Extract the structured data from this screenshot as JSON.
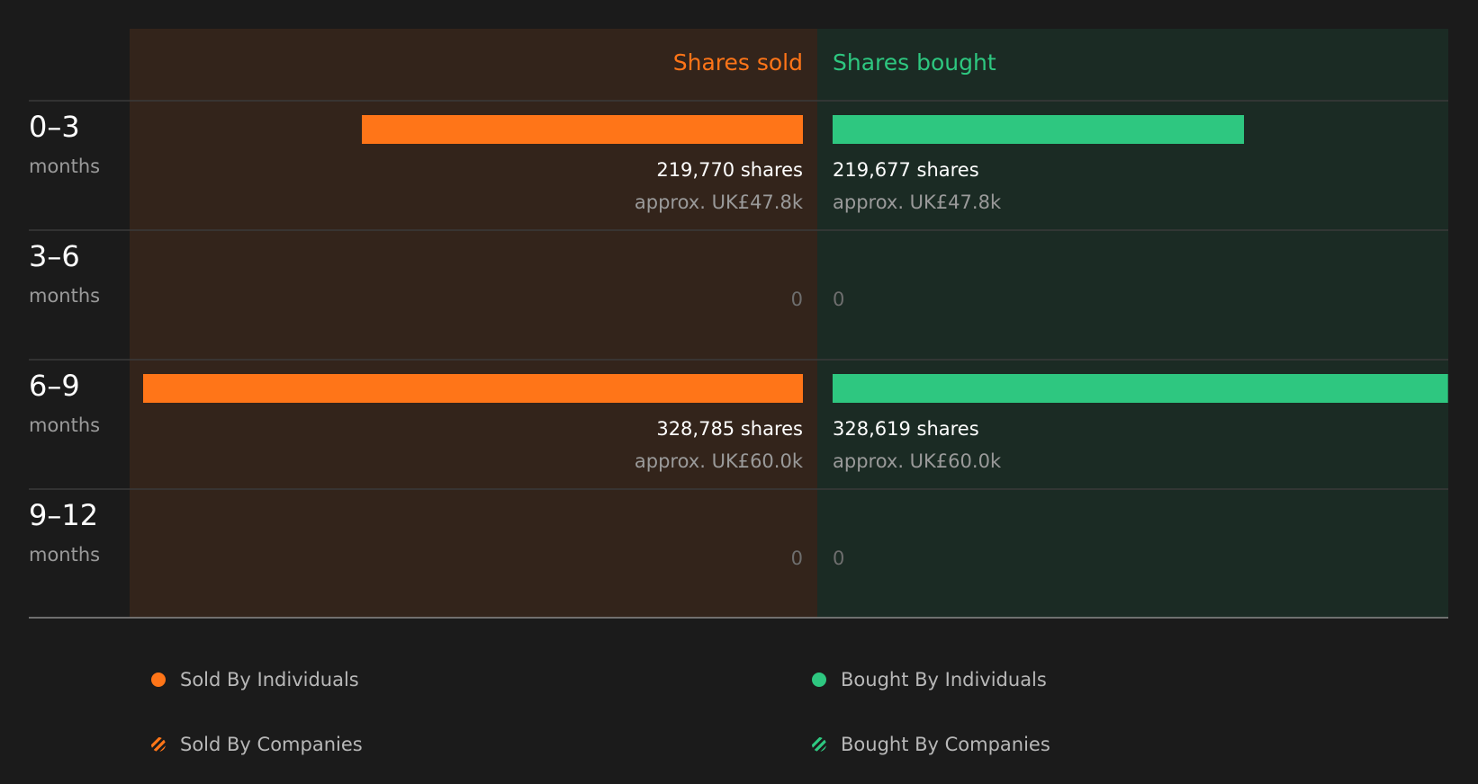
{
  "chart_data": {
    "type": "bar",
    "orientation": "diverging-horizontal",
    "sold_header": "Shares sold",
    "bought_header": "Shares bought",
    "max_shares": 328785,
    "categories": [
      {
        "range": "0–3",
        "unit": "months"
      },
      {
        "range": "3–6",
        "unit": "months"
      },
      {
        "range": "6–9",
        "unit": "months"
      },
      {
        "range": "9–12",
        "unit": "months"
      }
    ],
    "series": [
      {
        "name": "Shares sold",
        "values": [
          219770,
          0,
          328785,
          0
        ],
        "value_labels": [
          "219,770 shares",
          "0",
          "328,785 shares",
          "0"
        ],
        "approx_labels": [
          "approx. UK£47.8k",
          "",
          "approx. UK£60.0k",
          ""
        ]
      },
      {
        "name": "Shares bought",
        "values": [
          219677,
          0,
          328619,
          0
        ],
        "value_labels": [
          "219,677 shares",
          "0",
          "328,619 shares",
          "0"
        ],
        "approx_labels": [
          "approx. UK£47.8k",
          "",
          "approx. UK£60.0k",
          ""
        ]
      }
    ],
    "legend": [
      {
        "label": "Sold By Individuals",
        "style": "solid",
        "color": "#ff7518"
      },
      {
        "label": "Bought By Individuals",
        "style": "solid",
        "color": "#2ec780"
      },
      {
        "label": "Sold By Companies",
        "style": "hatched",
        "color": "#ff7518"
      },
      {
        "label": "Bought By Companies",
        "style": "hatched",
        "color": "#2ec780"
      }
    ],
    "legend_position": "bottom",
    "colors": {
      "background": "#1b1b1b",
      "sold_panel": "#33241b",
      "bought_panel": "#1b2b24",
      "sold": "#ff7518",
      "bought": "#2ec780",
      "label": "#ffffff",
      "muted": "#9a9a9a"
    }
  }
}
